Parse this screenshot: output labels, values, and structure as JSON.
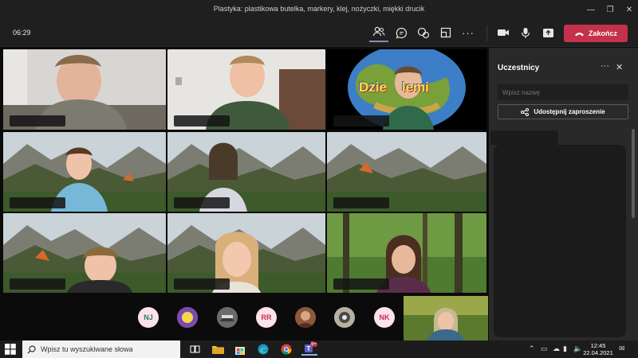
{
  "window": {
    "title": "Plastyka: plastikowa butelka, markery, klej, nożyczki, miękki drucik",
    "controls": [
      "minimize-icon",
      "restore-icon",
      "close-icon"
    ]
  },
  "toolbar": {
    "timer": "06:29",
    "icons": [
      "people-icon",
      "chat-icon",
      "reactions-icon",
      "rooms-icon",
      "more-icon",
      "camera-icon",
      "mic-icon",
      "share-icon"
    ],
    "hangup_label": "Zakończ"
  },
  "grid": {
    "tiles": [
      {
        "kind": "camera",
        "background": "room"
      },
      {
        "kind": "camera",
        "background": "room"
      },
      {
        "kind": "camera",
        "background": "globe",
        "overlay_text": "Dzie    lemi"
      },
      {
        "kind": "camera",
        "background": "mountains"
      },
      {
        "kind": "camera",
        "background": "mountains"
      },
      {
        "kind": "camera",
        "background": "mountains"
      },
      {
        "kind": "camera",
        "background": "mountains"
      },
      {
        "kind": "camera",
        "background": "mountains"
      },
      {
        "kind": "camera",
        "background": "forest"
      }
    ],
    "avatars": [
      {
        "type": "initials",
        "text": "NJ"
      },
      {
        "type": "photo",
        "icon": "avatar-photo"
      },
      {
        "type": "photo",
        "icon": "avatar-photo"
      },
      {
        "type": "initials",
        "text": "RR"
      },
      {
        "type": "photo",
        "icon": "avatar-photo"
      },
      {
        "type": "photo",
        "icon": "avatar-photo"
      },
      {
        "type": "initials",
        "text": "NK"
      }
    ]
  },
  "panel": {
    "title": "Uczestnicy",
    "search_placeholder": "Wpisz nazwę",
    "share_label": "Udostępnij zaproszenie"
  },
  "taskbar": {
    "search_placeholder": "Wpisz tu wyszukiwane słowa",
    "time": "12:45",
    "date": "22.04.2021",
    "teams_badge": "9+",
    "colors": {
      "accent": "#6264a7",
      "hangup": "#c4314b"
    }
  }
}
